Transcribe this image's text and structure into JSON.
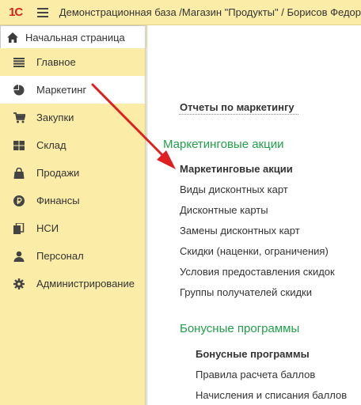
{
  "app": {
    "logo_text": "1С",
    "title": "Демонстрационная база /Магазин \"Продукты\" / Борисов Федор"
  },
  "tabs": {
    "home_label": "Начальная страница"
  },
  "sidebar": {
    "items": [
      {
        "label": "Главное",
        "icon": "list-icon"
      },
      {
        "label": "Маркетинг",
        "icon": "pie-chart-icon",
        "active": true
      },
      {
        "label": "Закупки",
        "icon": "cart-icon"
      },
      {
        "label": "Склад",
        "icon": "warehouse-icon"
      },
      {
        "label": "Продажи",
        "icon": "bag-icon"
      },
      {
        "label": "Финансы",
        "icon": "ruble-icon"
      },
      {
        "label": "НСИ",
        "icon": "documents-icon"
      },
      {
        "label": "Персонал",
        "icon": "person-icon"
      },
      {
        "label": "Администрирование",
        "icon": "gear-icon"
      }
    ]
  },
  "content": {
    "reports_link": "Отчеты по маркетингу",
    "section1": {
      "title": "Маркетинговые акции",
      "items": [
        "Маркетинговые акции",
        "Виды дисконтных карт",
        "Дисконтные карты",
        "Замены дисконтных карт",
        "Скидки (наценки, ограничения)",
        "Условия предоставления скидок",
        "Группы получателей скидки"
      ]
    },
    "section2": {
      "title": "Бонусные программы",
      "items": [
        "Бонусные программы",
        "Правила расчета баллов",
        "Начисления и списания баллов"
      ]
    }
  },
  "colors": {
    "panel_bg": "#fbeda8",
    "section_green": "#21a04a",
    "arrow_red": "#e02020",
    "logo_red": "#d4221c"
  }
}
